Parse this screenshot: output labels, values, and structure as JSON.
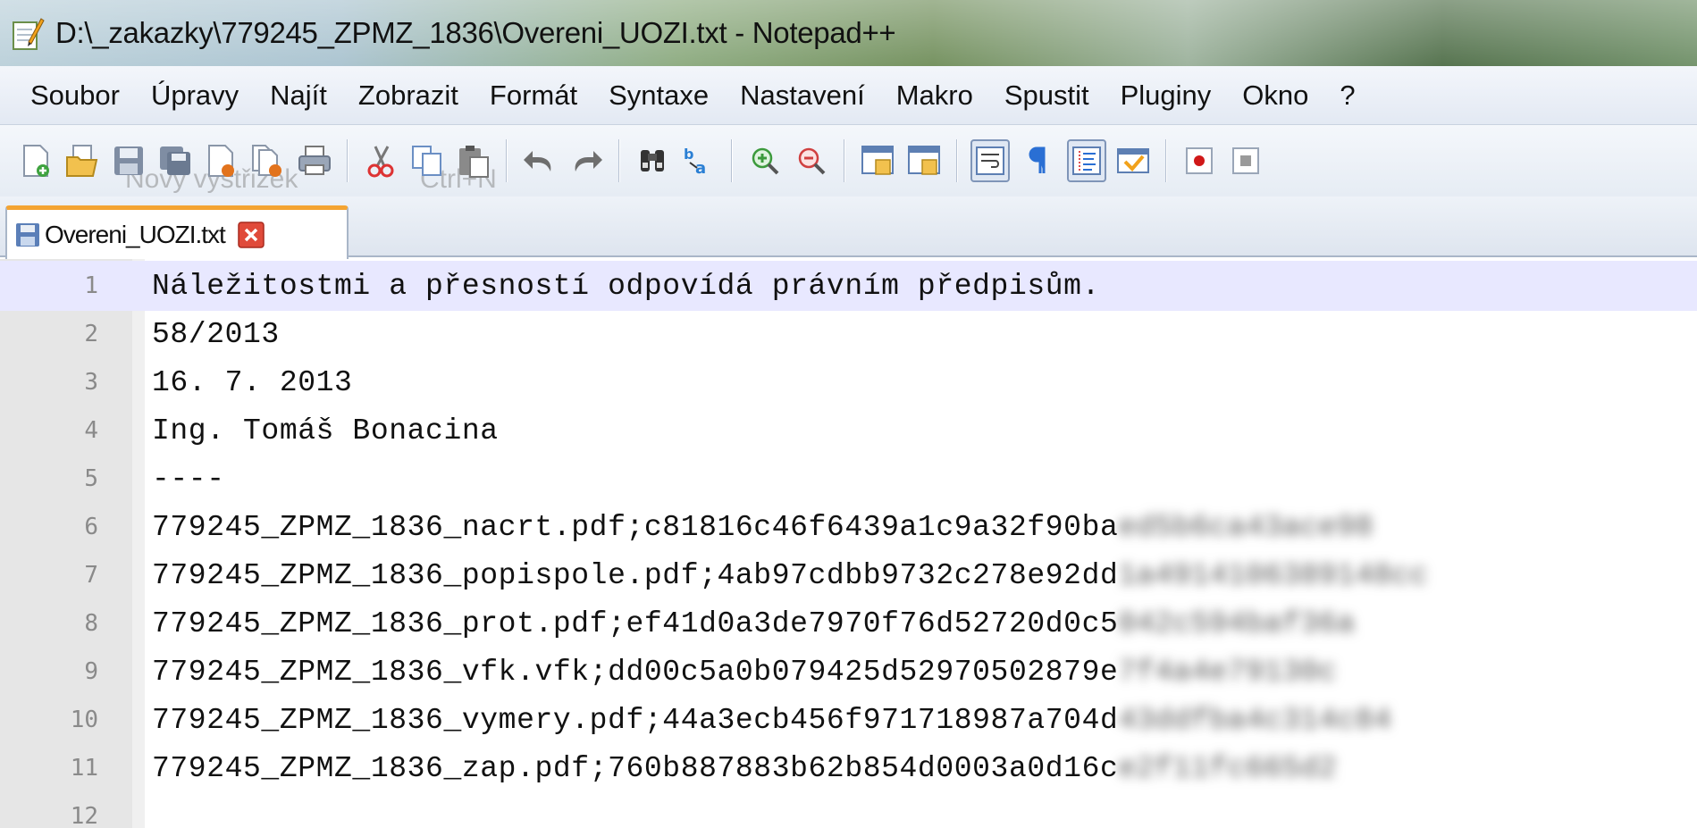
{
  "window": {
    "title": "D:\\_zakazky\\779245_ZPMZ_1836\\Overeni_UOZI.txt - Notepad++",
    "icon": "notepad-plus-plus-icon"
  },
  "menu": {
    "items": [
      "Soubor",
      "Úpravy",
      "Najít",
      "Zobrazit",
      "Formát",
      "Syntaxe",
      "Nastavení",
      "Makro",
      "Spustit",
      "Pluginy",
      "Okno",
      "?"
    ]
  },
  "toolbar": {
    "ghost_tooltip": "Nový výstřižek",
    "ghost_shortcut": "Ctrl+N",
    "buttons": [
      "new-file-icon",
      "open-file-icon",
      "save-icon",
      "save-all-icon",
      "close-icon",
      "close-all-icon",
      "print-icon",
      "cut-icon",
      "copy-icon",
      "paste-icon",
      "undo-icon",
      "redo-icon",
      "find-icon",
      "replace-icon",
      "zoom-in-icon",
      "zoom-out-icon",
      "sync-vertical-icon",
      "sync-horizontal-icon",
      "word-wrap-icon",
      "show-all-chars-icon",
      "indent-guide-icon",
      "document-map-icon",
      "record-macro-icon",
      "stop-macro-icon"
    ]
  },
  "tab": {
    "label": "Overeni_UOZI.txt"
  },
  "editor": {
    "lines": [
      {
        "num": "1",
        "text": "Náležitostmi a přesností odpovídá právním předpisům.",
        "hidden": ""
      },
      {
        "num": "2",
        "text": "58/2013",
        "hidden": ""
      },
      {
        "num": "3",
        "text": "16. 7. 2013",
        "hidden": ""
      },
      {
        "num": "4",
        "text": "Ing. Tomáš Bonacina",
        "hidden": ""
      },
      {
        "num": "5",
        "text": "----",
        "hidden": ""
      },
      {
        "num": "6",
        "text": "779245_ZPMZ_1836_nacrt.pdf;c81816c46f6439a1c9a32f90ba",
        "hidden": "ed5b6ca43ace98"
      },
      {
        "num": "7",
        "text": "779245_ZPMZ_1836_popispole.pdf;4ab97cdbb9732c278e92dd",
        "hidden": "1a4914106389148cc"
      },
      {
        "num": "8",
        "text": "779245_ZPMZ_1836_prot.pdf;ef41d0a3de7970f76d52720d0c5",
        "hidden": "042c594baf36a"
      },
      {
        "num": "9",
        "text": "779245_ZPMZ_1836_vfk.vfk;dd00c5a0b079425d52970502879e",
        "hidden": "7f4a4e79130c"
      },
      {
        "num": "10",
        "text": "779245_ZPMZ_1836_vymery.pdf;44a3ecb456f971718987a704d",
        "hidden": "43ddfba4c314c84"
      },
      {
        "num": "11",
        "text": "779245_ZPMZ_1836_zap.pdf;760b887883b62b854d0003a0d16c",
        "hidden": "e2f11fc665d2"
      },
      {
        "num": "12",
        "text": "",
        "hidden": ""
      }
    ]
  }
}
